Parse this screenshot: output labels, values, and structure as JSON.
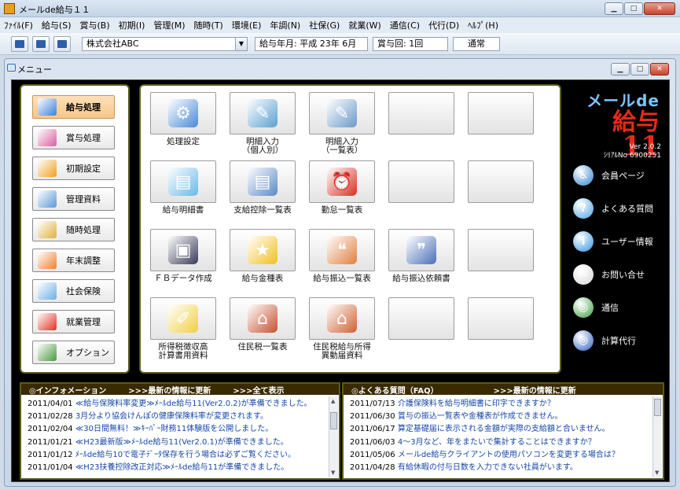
{
  "window": {
    "title": "メールde給与１１"
  },
  "menu": [
    "ﾌｧｲﾙ(F)",
    "給与(S)",
    "賞与(B)",
    "初期(I)",
    "管理(M)",
    "随時(T)",
    "環境(E)",
    "年調(N)",
    "社保(G)",
    "就業(W)",
    "通信(C)",
    "代行(D)",
    "ﾍﾙﾌﾟ(H)"
  ],
  "toolbar": {
    "company": "株式会社ABC",
    "pay_month": "給与年月: 平成 23年  6月",
    "bonus_times": "賞与回: 1回",
    "mode": "通常"
  },
  "mdi": {
    "title": "メニュー"
  },
  "nav": [
    {
      "label": "給与処理",
      "icon": "payroll-icon",
      "color": "#3a7fd8"
    },
    {
      "label": "賞与処理",
      "icon": "bonus-icon",
      "color": "#d85fa0"
    },
    {
      "label": "初期設定",
      "icon": "gear-icon",
      "color": "#f0a020"
    },
    {
      "label": "管理資料",
      "icon": "documents-icon",
      "color": "#5a9ad8"
    },
    {
      "label": "随時処理",
      "icon": "puzzle-icon",
      "color": "#e0b040"
    },
    {
      "label": "年末調整",
      "icon": "pencil-icon",
      "color": "#f08030"
    },
    {
      "label": "社会保険",
      "icon": "certificate-icon",
      "color": "#6ab0e8"
    },
    {
      "label": "就業管理",
      "icon": "clock-icon",
      "color": "#e03020"
    },
    {
      "label": "オプション",
      "icon": "tools-icon",
      "color": "#4a9a40"
    }
  ],
  "tiles": [
    {
      "label": "処理設定",
      "icon": "settings-tools-icon",
      "color": "#4a8ad8",
      "glyph": "⚙"
    },
    {
      "label": "明細入力\n（個人別）",
      "icon": "edit-person-icon",
      "color": "#5aa0d0",
      "glyph": "✎"
    },
    {
      "label": "明細入力\n（一覧表）",
      "icon": "edit-list-icon",
      "color": "#6a9ac8",
      "glyph": "✎"
    },
    {
      "label": "",
      "icon": "",
      "color": "",
      "glyph": ""
    },
    {
      "label": "",
      "icon": "",
      "color": "",
      "glyph": ""
    },
    {
      "label": "給与明細書",
      "icon": "payslip-icon",
      "color": "#6ab8e8",
      "glyph": "▤"
    },
    {
      "label": "支給控除一覧表",
      "icon": "deduction-list-icon",
      "color": "#5a8ac8",
      "glyph": "▤"
    },
    {
      "label": "勤怠一覧表",
      "icon": "alarm-clock-icon",
      "color": "#d83020",
      "glyph": "⏰"
    },
    {
      "label": "",
      "icon": "",
      "color": "",
      "glyph": ""
    },
    {
      "label": "",
      "icon": "",
      "color": "",
      "glyph": ""
    },
    {
      "label": "ＦＢデータ作成",
      "icon": "floppy-disk-icon",
      "color": "#3a3a5a",
      "glyph": "▣"
    },
    {
      "label": "給与金種表",
      "icon": "star-icon",
      "color": "#f0c020",
      "glyph": "★"
    },
    {
      "label": "給与振込一覧表",
      "icon": "transfer-list-icon",
      "color": "#e08040",
      "glyph": "❝"
    },
    {
      "label": "給与振込依頼書",
      "icon": "transfer-request-icon",
      "color": "#4a70b8",
      "glyph": "❞"
    },
    {
      "label": "",
      "icon": "",
      "color": "",
      "glyph": ""
    },
    {
      "label": "所得税徴収高\n計算書用資料",
      "icon": "sticky-note-icon",
      "color": "#f0d040",
      "glyph": "✐"
    },
    {
      "label": "住民税一覧表",
      "icon": "house-icon",
      "color": "#c85030",
      "glyph": "⌂"
    },
    {
      "label": "住民税給与所得\n異動届資料",
      "icon": "house-settings-icon",
      "color": "#d06030",
      "glyph": "⌂"
    },
    {
      "label": "",
      "icon": "",
      "color": "",
      "glyph": ""
    },
    {
      "label": "",
      "icon": "",
      "color": "",
      "glyph": ""
    }
  ],
  "logo": {
    "line1": "メールde",
    "line2a": "給与",
    "line2b": "11",
    "version": "Ver 2.0.2",
    "serial": "ｼﾘｱﾙNo 6900251"
  },
  "links": [
    {
      "label": "会員ページ",
      "icon": "member-icon",
      "color": "#2a80d0",
      "glyph": "♿"
    },
    {
      "label": "よくある質問",
      "icon": "faq-icon",
      "color": "#4aa0e0",
      "glyph": "?"
    },
    {
      "label": "ユーザー情報",
      "icon": "info-icon",
      "color": "#2a90e0",
      "glyph": "i"
    },
    {
      "label": "お問い合せ",
      "icon": "mail-icon",
      "color": "#d8d8d8",
      "glyph": "✉"
    },
    {
      "label": "通信",
      "icon": "globe-icon",
      "color": "#3aa040",
      "glyph": "◎"
    },
    {
      "label": "計算代行",
      "icon": "earth-icon",
      "color": "#2a60c0",
      "glyph": "◎"
    }
  ],
  "info": {
    "head": "◎インフォメーション",
    "update": ">>>最新の情報に更新",
    "all": ">>>全て表示",
    "rows": [
      {
        "date": "2011/04/01",
        "text": "≪給与保険料率変更≫ﾒｰﾙde給与11(Ver2.0.2)が準備できました。"
      },
      {
        "date": "2011/02/28",
        "text": "3月分より協会けんぽの健康保険料率が変更されます。"
      },
      {
        "date": "2011/02/04",
        "text": "≪30日間無料！≫ｷｰﾊﾟｰ財務11体験版を公開しました。"
      },
      {
        "date": "2011/01/21",
        "text": "≪H23最新版≫ﾒｰﾙde給与11(Ver2.0.1)が準備できました。"
      },
      {
        "date": "2011/01/12",
        "text": "ﾒｰﾙde給与10で電子ﾃﾞｰﾀ保存を行う場合は必ずご覧ください。"
      },
      {
        "date": "2011/01/04",
        "text": "≪H23扶養控除改正対応≫ﾒｰﾙde給与11が準備できました。"
      }
    ]
  },
  "faq": {
    "head": "◎よくある質問（FAQ）",
    "update": ">>>最新の情報に更新",
    "rows": [
      {
        "date": "2011/07/13",
        "text": "介護保険料を給与明細書に印字できますか？"
      },
      {
        "date": "2011/06/30",
        "text": "賞与の振込一覧表や金種表が作成できません。"
      },
      {
        "date": "2011/06/17",
        "text": "算定基礎届に表示される金額が実際の支給額と合いません。"
      },
      {
        "date": "2011/06/03",
        "text": "4～3月など、年をまたいで集計することはできますか？"
      },
      {
        "date": "2011/05/06",
        "text": "メールde給与クライアントの使用パソコンを変更する場合は？"
      },
      {
        "date": "2011/04/28",
        "text": "有給休暇の付与日数を入力できない社員がいます。"
      }
    ]
  }
}
